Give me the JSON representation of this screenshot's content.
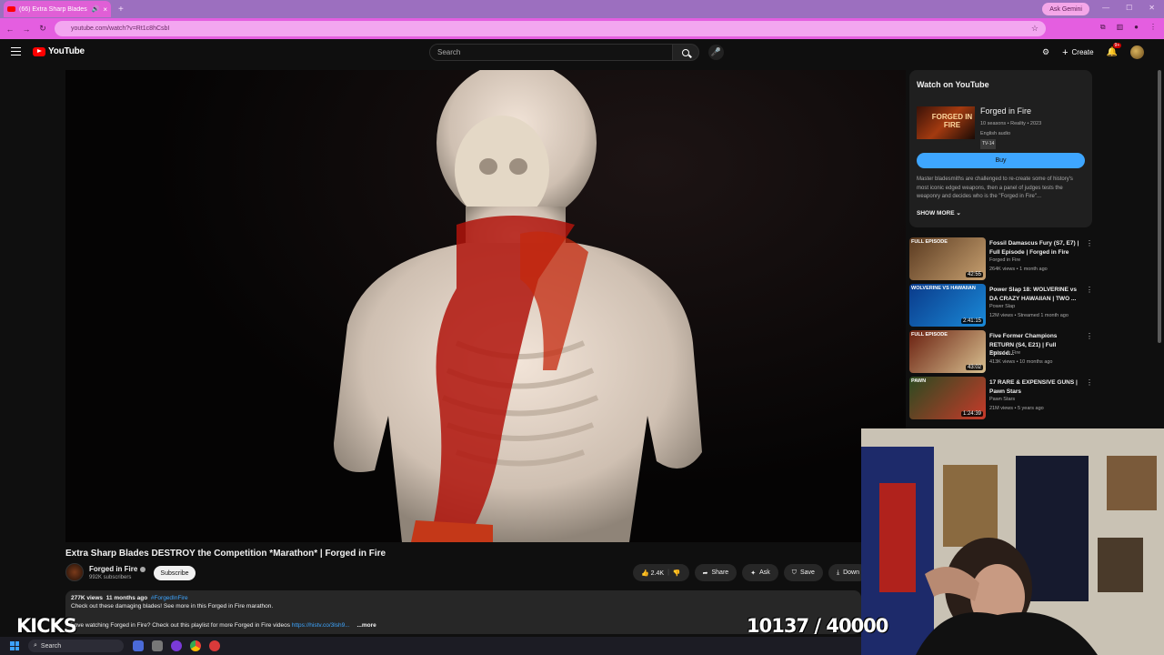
{
  "browser": {
    "tab_title": "(66) Extra Sharp Blades DE",
    "tab_close": "×",
    "new_tab": "+",
    "ask_gemini": "Ask Gemini",
    "url": "youtube.com/watch?v=Rt1c8hCsbI"
  },
  "youtube_header": {
    "logo_text": "YouTube",
    "search_placeholder": "Search",
    "create_label": "Create",
    "notifications_count": "9+"
  },
  "video": {
    "title": "Extra Sharp Blades DESTROY the Competition *Marathon* | Forged in Fire",
    "channel": "Forged in Fire",
    "subscribers": "992K subscribers",
    "subscribe_label": "Subscribe",
    "likes": "2.4K",
    "share_label": "Share",
    "ask_label": "Ask",
    "save_label": "Save",
    "download_label": "Down",
    "views": "277K views",
    "age": "11 months ago",
    "hashtag": "#ForgedInFire",
    "desc_line1": "Check out these damaging blades! See more in this Forged in Fire marathon.",
    "desc_line2": "Love watching Forged in Fire? Check out this playlist for more Forged in Fire videos",
    "desc_link": "https://histv.co/3lsh9...",
    "more_label": "...more"
  },
  "watch_card": {
    "heading": "Watch on YouTube",
    "show_title": "Forged in Fire",
    "thumb_text": "FORGED IN FIRE",
    "meta": "10 seasons • Reality • 2023",
    "audio": "English audio",
    "rating": "TV-14",
    "buy_label": "Buy",
    "description": "Master bladesmiths are challenged to re-create some of history's most iconic edged weapons, then a panel of judges tests the weaponry and decides who is the \"Forged in Fire\"...",
    "show_more": "SHOW MORE"
  },
  "recommendations": [
    {
      "title": "Fossil Damascus Fury (S7, E7) | Full Episode | Forged in Fire",
      "channel": "Forged in Fire",
      "stats": "264K views • 1 month ago",
      "duration": "42:55",
      "label": "FULL EPISODE",
      "colors": [
        "#5a3a20",
        "#c7a070"
      ]
    },
    {
      "title": "Power Slap 18: WOLVERINE vs DA CRAZY HAWAIIAN | TWO ...",
      "channel": "Power Slap",
      "stats": "12M views • Streamed 1 month ago",
      "duration": "2:41:15",
      "label": "WOLVERINE VS HAWAIIAN",
      "colors": [
        "#0a3a8a",
        "#1a8ad8"
      ]
    },
    {
      "title": "Five Former Champions RETURN (S4, E21) | Full Episod...",
      "channel": "Forged in Fire",
      "stats": "413K views • 10 months ago",
      "duration": "43:02",
      "label": "FULL EPISODE",
      "colors": [
        "#6a2010",
        "#d8c090"
      ]
    },
    {
      "title": "17 RARE & EXPENSIVE GUNS | Pawn Stars",
      "channel": "Pawn Stars",
      "stats": "21M views • 5 years ago",
      "duration": "1:24:39",
      "label": "PAWN",
      "colors": [
        "#2a4a20",
        "#c83a2a"
      ]
    }
  ],
  "overlay": {
    "left_text": "KICKS",
    "counter": "10137 / 40000"
  },
  "taskbar": {
    "search_label": "Search"
  }
}
